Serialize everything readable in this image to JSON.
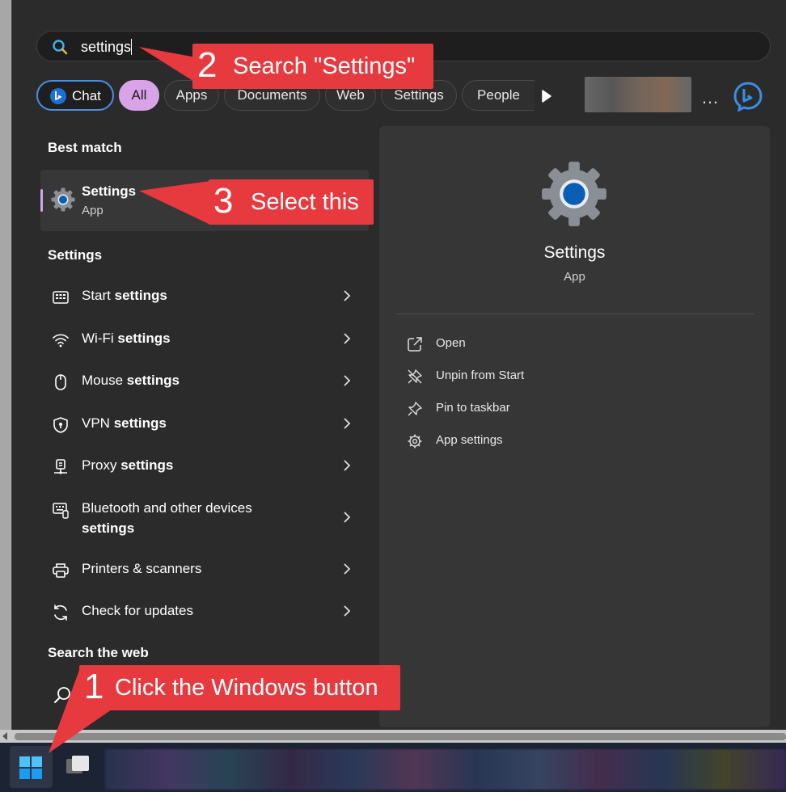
{
  "search": {
    "query": "settings"
  },
  "filters": {
    "chat": "Chat",
    "all": "All",
    "apps": "Apps",
    "documents": "Documents",
    "web": "Web",
    "settings": "Settings",
    "people": "People",
    "more": "…"
  },
  "best_match": {
    "heading": "Best match",
    "title": "Settings",
    "subtitle": "App"
  },
  "settings_section": {
    "heading": "Settings",
    "items": [
      {
        "prefix": "Start ",
        "bold": "settings",
        "icon": "start-menu-icon"
      },
      {
        "prefix": "Wi-Fi ",
        "bold": "settings",
        "icon": "wifi-icon"
      },
      {
        "prefix": "Mouse ",
        "bold": "settings",
        "icon": "mouse-icon"
      },
      {
        "prefix": "VPN ",
        "bold": "settings",
        "icon": "vpn-shield-icon"
      },
      {
        "prefix": "Proxy ",
        "bold": "settings",
        "icon": "proxy-icon"
      },
      {
        "prefix": "Bluetooth and other devices",
        "bold": "settings",
        "icon": "bluetooth-devices-icon"
      },
      {
        "label": "Printers & scanners",
        "icon": "printer-icon"
      },
      {
        "label": "Check for updates",
        "icon": "update-icon"
      }
    ]
  },
  "web_section": {
    "heading": "Search the web"
  },
  "detail": {
    "title": "Settings",
    "subtitle": "App",
    "actions": [
      {
        "label": "Open",
        "icon": "open-external-icon"
      },
      {
        "label": "Unpin from Start",
        "icon": "unpin-icon"
      },
      {
        "label": "Pin to taskbar",
        "icon": "pin-icon"
      },
      {
        "label": "App settings",
        "icon": "gear-icon"
      }
    ]
  },
  "callouts": [
    {
      "number": "1",
      "text": "Click the Windows button"
    },
    {
      "number": "2",
      "text": "Search \"Settings\""
    },
    {
      "number": "3",
      "text": "Select this"
    }
  ],
  "colors": {
    "accent": "#d9a3e7",
    "callout": "#e63a3f",
    "chat_border": "#4a90e2",
    "settings_blue": "#0a5fb4"
  }
}
